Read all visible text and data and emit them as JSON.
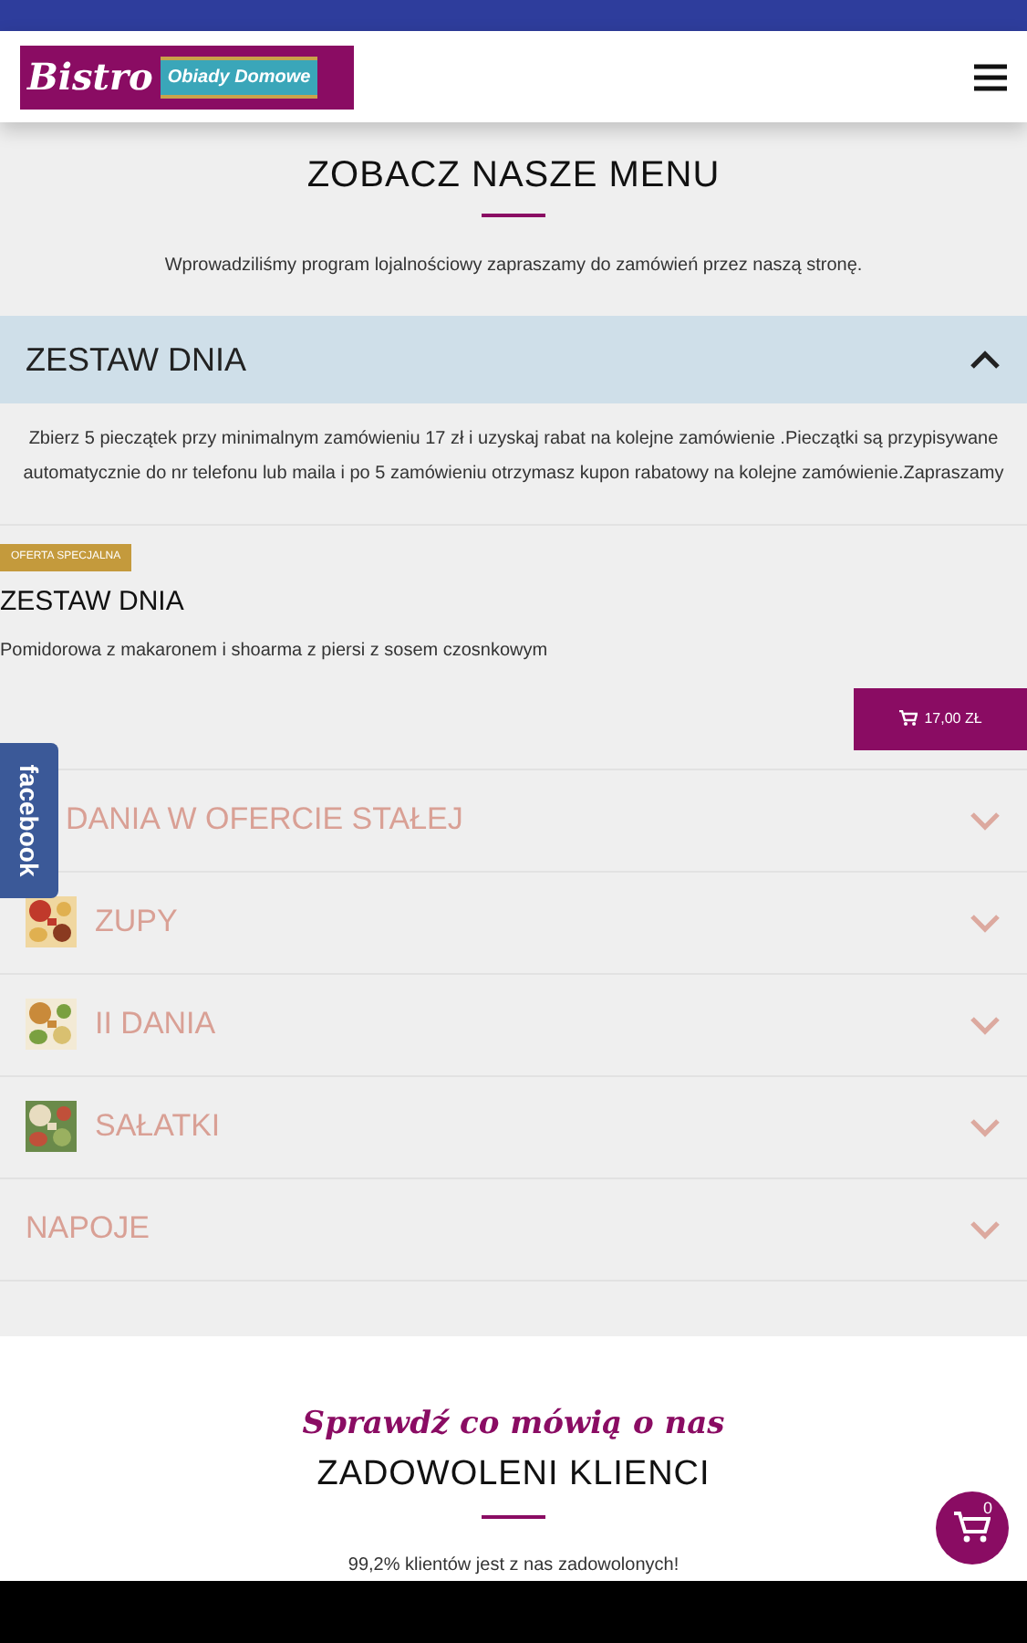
{
  "header": {
    "logo_main": "Bistro",
    "logo_ribbon": "Obiady Domowe"
  },
  "menu_section": {
    "title": "ZOBACZ NASZE MENU",
    "intro": "Wprowadziliśmy program lojalnościowy zapraszamy do zamówień przez naszą stronę."
  },
  "featured_category": {
    "title": "ZESTAW DNIA",
    "expanded": true,
    "description": "Zbierz 5 pieczątek przy minimalnym zamówieniu 17 zł i uzyskaj rabat na kolejne zamówienie .Pieczątki są przypisywane automatycznie do nr telefonu lub maila i po 5 zamówieniu otrzymasz kupon rabatowy na kolejne zamówienie.Zapraszamy",
    "product": {
      "badge": "OFERTA SPECJALNA",
      "name": "ZESTAW DNIA",
      "description": "Pomidorowa z makaronem i shoarma z piersi z sosem czosnkowym",
      "price": "17,00 ZŁ"
    }
  },
  "categories": [
    {
      "kind": "plain",
      "title": "DANIA W OFERCIE STAŁEJ",
      "expanded": false
    },
    {
      "kind": "with_image",
      "title": "ZUPY",
      "expanded": false
    },
    {
      "kind": "with_image",
      "title": "II DANIA",
      "expanded": false
    },
    {
      "kind": "with_image",
      "title": "SAŁATKI",
      "expanded": false
    },
    {
      "kind": "plain",
      "title": "NAPOJE",
      "expanded": false
    }
  ],
  "facebook_tab": "facebook",
  "reviews": {
    "subtitle": "Sprawdź co mówią o nas",
    "title": "ZADOWOLENI KLIENCI",
    "text": "99,2% klientów jest z nas zadowolonych!"
  },
  "cart": {
    "count": "0"
  }
}
